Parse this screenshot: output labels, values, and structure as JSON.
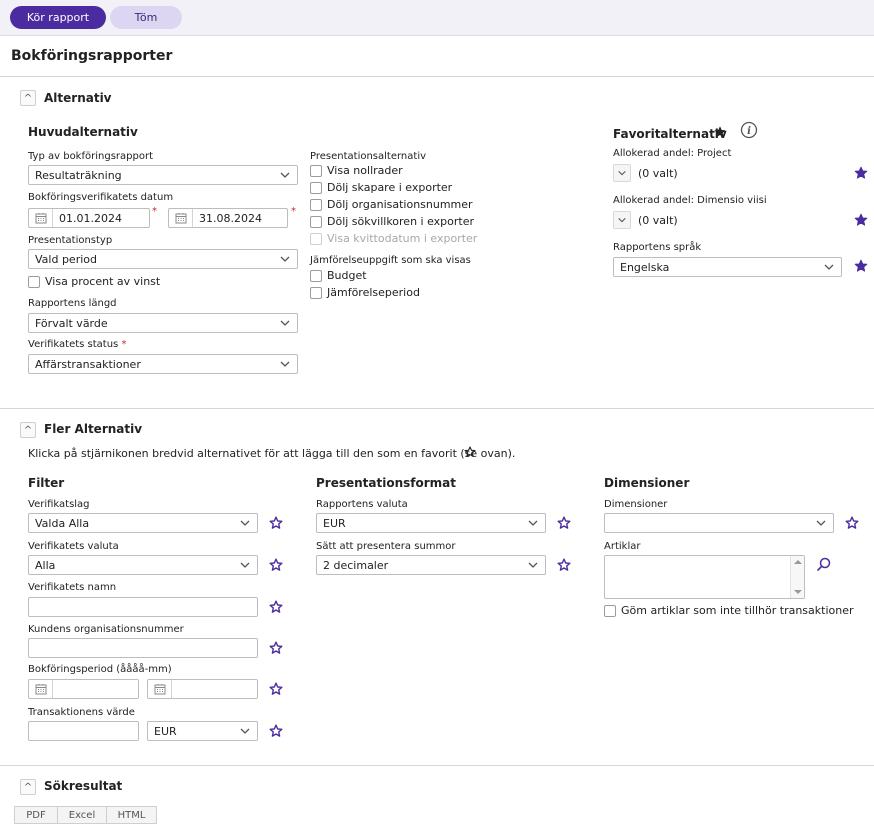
{
  "toolbar": {
    "run_label": "Kör rapport",
    "clear_label": "Töm"
  },
  "page_title": "Bokföringsrapporter",
  "alternativ": {
    "title": "Alternativ",
    "main": {
      "title": "Huvudalternativ",
      "report_type_label": "Typ av bokföringsrapport",
      "report_type_value": "Resultaträkning",
      "voucher_date_label": "Bokföringsverifikatets datum",
      "date_from": "01.01.2024",
      "date_to": "31.08.2024",
      "presentation_type_label": "Presentationstyp",
      "presentation_type_value": "Vald period",
      "show_percent_label": "Visa procent av vinst",
      "report_length_label": "Rapportens längd",
      "report_length_value": "Förvalt värde",
      "voucher_status_label": "Verifikatets status",
      "voucher_status_value": "Affärstransaktioner"
    },
    "presentation": {
      "title": "Presentationsalternativ",
      "options": [
        "Visa nollrader",
        "Dölj skapare i exporter",
        "Dölj organisationsnummer",
        "Dölj sökvillkoren i exporter",
        "Visa kvittodatum i exporter"
      ],
      "compare_title": "Jämförelseuppgift som ska visas",
      "compare_options": [
        "Budget",
        "Jämförelseperiod"
      ]
    },
    "favorites": {
      "title": "Favoritalternativ",
      "alloc_project_label": "Allokerad andel: Project",
      "alloc_project_value": "(0 valt)",
      "alloc_dim_label": "Allokerad andel: Dimensio viisi",
      "alloc_dim_value": "(0 valt)",
      "language_label": "Rapportens språk",
      "language_value": "Engelska"
    }
  },
  "more": {
    "title": "Fler Alternativ",
    "hint": "Klicka på stjärnikonen bredvid alternativet för att lägga till den som en favorit (se ovan).",
    "filter": {
      "title": "Filter",
      "voucher_type_label": "Verifikatslag",
      "voucher_type_value": "Valda Alla",
      "voucher_currency_label": "Verifikatets valuta",
      "voucher_currency_value": "Alla",
      "voucher_name_label": "Verifikatets namn",
      "customer_org_label": "Kundens organisationsnummer",
      "period_label": "Bokföringsperiod (åååå-mm)",
      "tx_value_label": "Transaktionens värde",
      "tx_currency_value": "EUR"
    },
    "format": {
      "title": "Presentationsformat",
      "currency_label": "Rapportens valuta",
      "currency_value": "EUR",
      "sum_label": "Sätt att presentera summor",
      "sum_value": "2 decimaler"
    },
    "dimensions": {
      "title": "Dimensioner",
      "dimensions_label": "Dimensioner",
      "dimensions_value": "",
      "articles_label": "Artiklar",
      "hide_articles_label": "Göm artiklar som inte tillhör transaktioner"
    }
  },
  "results": {
    "title": "Sökresultat",
    "export_tabs": [
      "PDF",
      "Excel",
      "HTML"
    ]
  },
  "colors": {
    "primary": "#4b2ca0",
    "primary_light": "#ddd6f3",
    "required": "#d2232a"
  }
}
